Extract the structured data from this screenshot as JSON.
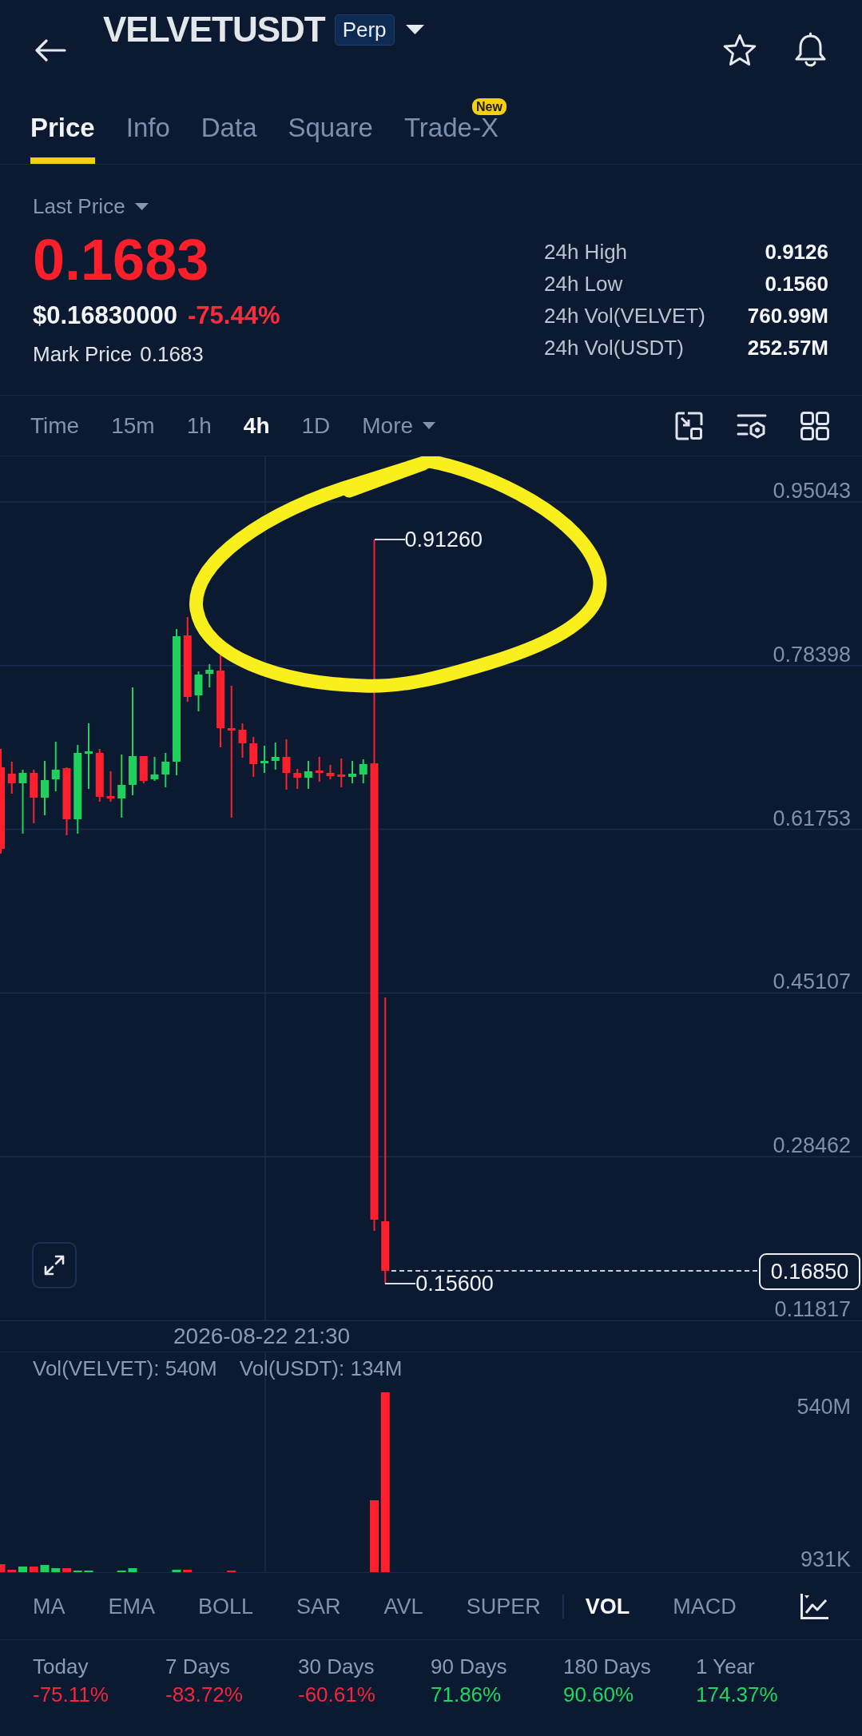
{
  "header": {
    "title": "VELVETUSDT",
    "badge": "Perp"
  },
  "tabs": [
    {
      "label": "Price",
      "selected": true
    },
    {
      "label": "Info",
      "selected": false
    },
    {
      "label": "Data",
      "selected": false
    },
    {
      "label": "Square",
      "selected": false
    },
    {
      "label": "Trade-X",
      "selected": false,
      "badge": "New"
    }
  ],
  "price": {
    "selector": "Last Price",
    "last": "0.1683",
    "usd": "$0.16830000",
    "change": "-75.44%",
    "mark_label": "Mark Price",
    "mark": "0.1683",
    "stats": [
      {
        "label": "24h High",
        "value": "0.9126"
      },
      {
        "label": "24h Low",
        "value": "0.1560"
      },
      {
        "label": "24h Vol(VELVET)",
        "value": "760.99M"
      },
      {
        "label": "24h Vol(USDT)",
        "value": "252.57M"
      }
    ]
  },
  "timeframes": [
    {
      "label": "Time",
      "selected": false
    },
    {
      "label": "15m",
      "selected": false
    },
    {
      "label": "1h",
      "selected": false
    },
    {
      "label": "4h",
      "selected": true
    },
    {
      "label": "1D",
      "selected": false
    }
  ],
  "more_menu": "More",
  "chart": {
    "price_axis": [
      "0.95043",
      "0.78398",
      "0.61753",
      "0.45107",
      "0.28462",
      "0.11817"
    ],
    "high_label": "0.91260",
    "low_label": "0.15600",
    "current_price": "0.16850",
    "time_label": "2026-08-22 21:30"
  },
  "volume": {
    "legend": [
      "Vol(VELVET): 540M",
      "Vol(USDT): 134M"
    ],
    "axis": [
      "540M",
      "931K"
    ]
  },
  "main_indicators": [
    {
      "label": "MA",
      "selected": false
    },
    {
      "label": "EMA",
      "selected": false
    },
    {
      "label": "BOLL",
      "selected": false
    },
    {
      "label": "SAR",
      "selected": false
    },
    {
      "label": "AVL",
      "selected": false
    },
    {
      "label": "SUPER",
      "selected": false
    }
  ],
  "sub_indicators": [
    {
      "label": "VOL",
      "selected": true
    },
    {
      "label": "MACD",
      "selected": false
    }
  ],
  "performance": [
    {
      "label": "Today",
      "value": "-75.11%",
      "color": "#f7253a"
    },
    {
      "label": "7 Days",
      "value": "-83.72%",
      "color": "#f7253a"
    },
    {
      "label": "30 Days",
      "value": "-60.61%",
      "color": "#f7253a"
    },
    {
      "label": "90 Days",
      "value": "71.86%",
      "color": "#1ed760"
    },
    {
      "label": "180 Days",
      "value": "90.60%",
      "color": "#1ed760"
    },
    {
      "label": "1 Year",
      "value": "174.37%",
      "color": "#1ed760"
    }
  ]
}
